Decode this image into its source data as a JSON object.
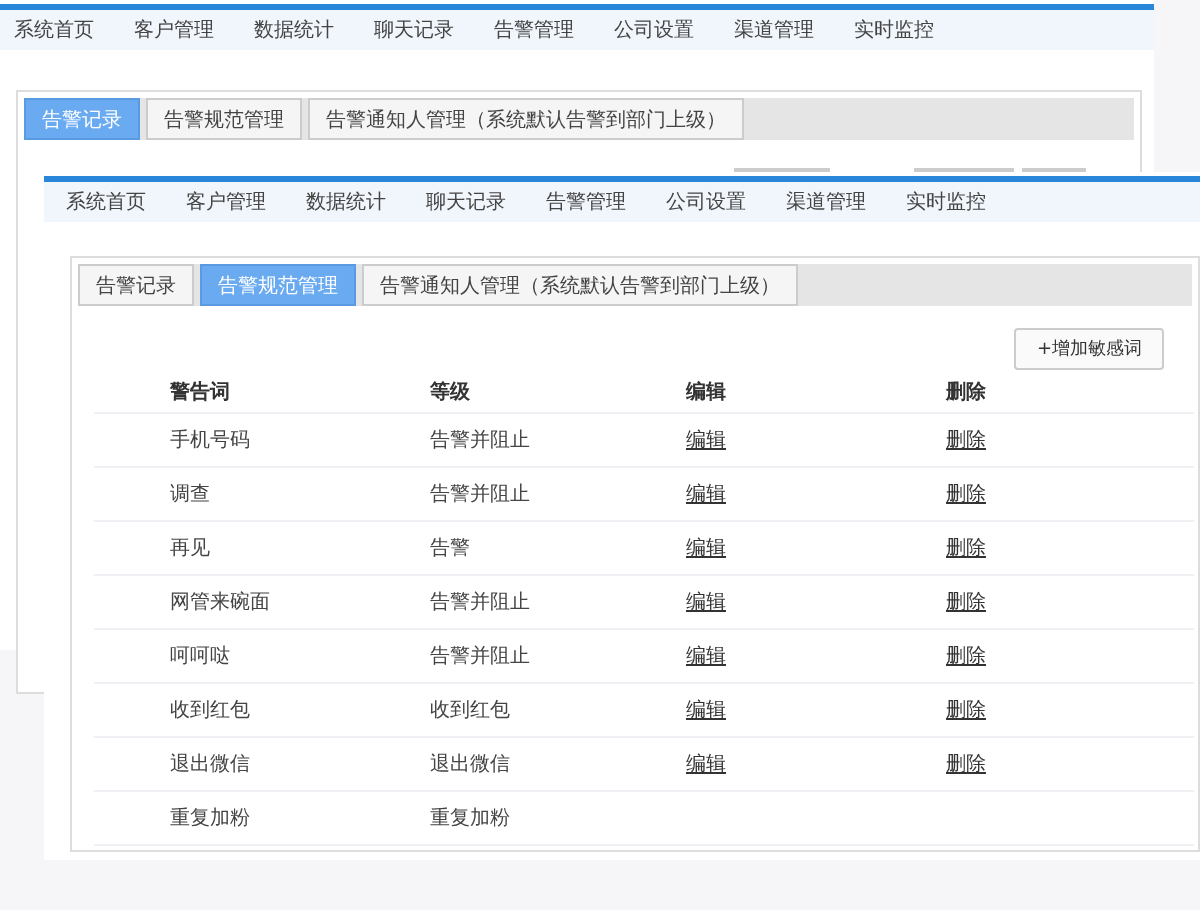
{
  "back_screen": {
    "nav": [
      "系统首页",
      "客户管理",
      "数据统计",
      "聊天记录",
      "告警管理",
      "公司设置",
      "渠道管理",
      "实时监控"
    ],
    "tabs": [
      {
        "label": "告警记录",
        "selected": true
      },
      {
        "label": "告警规范管理",
        "selected": false
      },
      {
        "label": "告警通知人管理（系统默认告警到部门上级）",
        "selected": false
      }
    ]
  },
  "front_screen": {
    "nav": [
      "系统首页",
      "客户管理",
      "数据统计",
      "聊天记录",
      "告警管理",
      "公司设置",
      "渠道管理",
      "实时监控"
    ],
    "tabs": [
      {
        "label": "告警记录",
        "selected": false
      },
      {
        "label": "告警规范管理",
        "selected": true
      },
      {
        "label": "告警通知人管理（系统默认告警到部门上级）",
        "selected": false
      }
    ],
    "add_button": "+增加敏感词",
    "table": {
      "columns": [
        "警告词",
        "等级",
        "编辑",
        "删除"
      ],
      "rows": [
        {
          "word": "手机号码",
          "level": "告警并阻止",
          "edit": "编辑",
          "delete": "删除"
        },
        {
          "word": "调查",
          "level": "告警并阻止",
          "edit": "编辑",
          "delete": "删除"
        },
        {
          "word": "再见",
          "level": "告警",
          "edit": "编辑",
          "delete": "删除"
        },
        {
          "word": "网管来碗面",
          "level": "告警并阻止",
          "edit": "编辑",
          "delete": "删除"
        },
        {
          "word": "呵呵哒",
          "level": "告警并阻止",
          "edit": "编辑",
          "delete": "删除"
        },
        {
          "word": "收到红包",
          "level": "收到红包",
          "edit": "编辑",
          "delete": "删除"
        },
        {
          "word": "退出微信",
          "level": "退出微信",
          "edit": "编辑",
          "delete": "删除"
        },
        {
          "word": "重复加粉",
          "level": "重复加粉"
        }
      ]
    }
  }
}
